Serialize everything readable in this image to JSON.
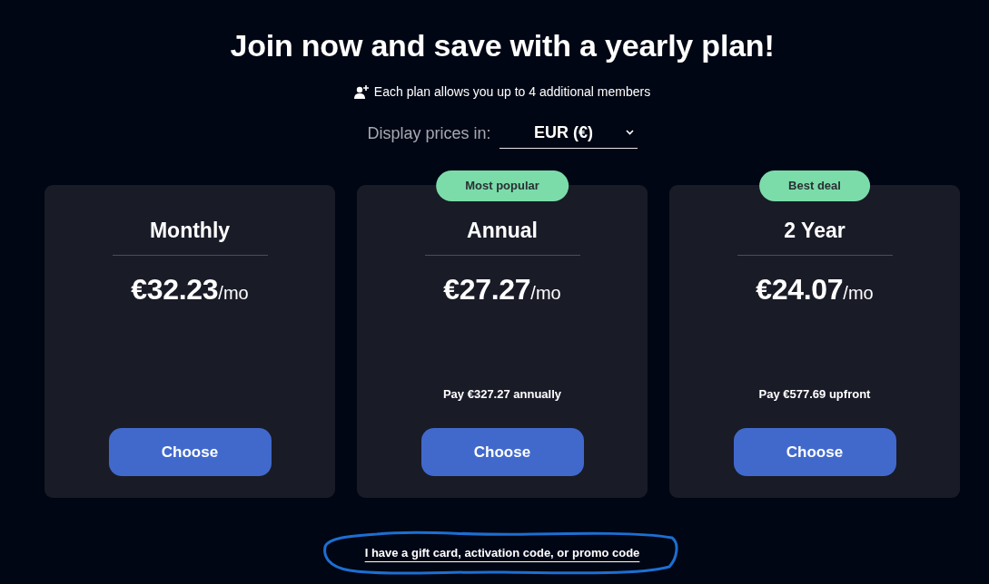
{
  "header": {
    "title": "Join now and save with a yearly plan!",
    "members_note": "Each plan allows you up to 4 additional members"
  },
  "currency": {
    "label": "Display prices in:",
    "value": "EUR (€)"
  },
  "plans": [
    {
      "name": "Monthly",
      "price": "€32.23",
      "period": "/mo",
      "button": "Choose"
    },
    {
      "badge": "Most popular",
      "name": "Annual",
      "price": "€27.27",
      "period": "/mo",
      "note": "Pay €327.27 annually",
      "button": "Choose"
    },
    {
      "badge": "Best deal",
      "name": "2 Year",
      "price": "€24.07",
      "period": "/mo",
      "note": "Pay €577.69 upfront",
      "button": "Choose"
    }
  ],
  "gift_link": {
    "text": "I have a gift card, activation code, or promo code",
    "circled": true
  }
}
